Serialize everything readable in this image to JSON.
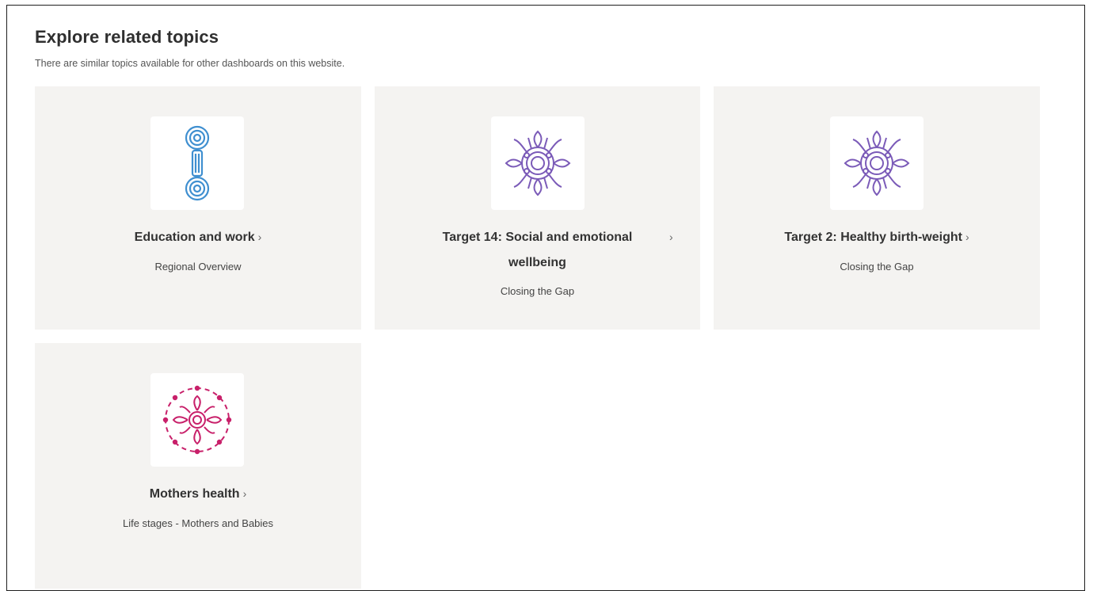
{
  "section": {
    "title": "Explore related topics",
    "subtitle": "There are similar topics available for other dashboards on this website."
  },
  "cards": [
    {
      "title": "Education and work",
      "chevron": "›",
      "subtitle": "Regional Overview",
      "icon": "concentric-circles-link-icon",
      "icon_color": "#3f8fd0"
    },
    {
      "title_line1": "Target 14: Social and emotional",
      "title_line2": "wellbeing",
      "chevron": "›",
      "subtitle": "Closing the Gap",
      "icon": "radiating-sun-icon",
      "icon_color": "#7b5bb8"
    },
    {
      "title": "Target 2: Healthy birth-weight",
      "chevron": "›",
      "subtitle": "Closing the Gap",
      "icon": "radiating-sun-icon",
      "icon_color": "#7b5bb8"
    },
    {
      "title": "Mothers health",
      "chevron": "›",
      "subtitle": "Life stages - Mothers and Babies",
      "icon": "dotted-ring-flower-icon",
      "icon_color": "#c8206a"
    }
  ],
  "colors": {
    "card_background": "#f4f3f1",
    "border": "#1f1f1f"
  }
}
